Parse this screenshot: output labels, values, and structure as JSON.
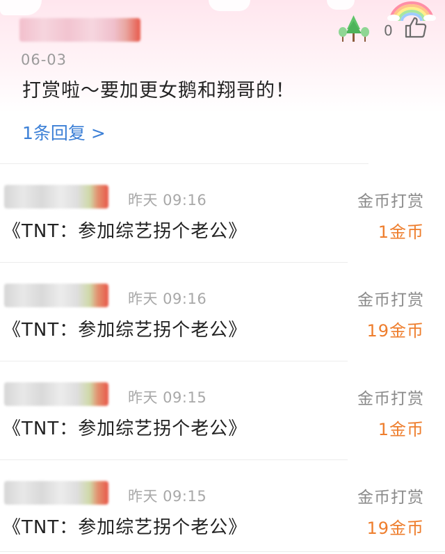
{
  "comment_card": {
    "date": "06-03",
    "text": "打赏啦～要加更女鹅和翔哥的！",
    "like_count": "0",
    "reply_link": "1条回复 >"
  },
  "rewards": [
    {
      "time": "昨天 09:16",
      "type": "金币打赏",
      "title": "《TNT：参加综艺拐个老公》",
      "amount": "1金币"
    },
    {
      "time": "昨天 09:16",
      "type": "金币打赏",
      "title": "《TNT：参加综艺拐个老公》",
      "amount": "19金币"
    },
    {
      "time": "昨天 09:15",
      "type": "金币打赏",
      "title": "《TNT：参加综艺拐个老公》",
      "amount": "1金币"
    },
    {
      "time": "昨天 09:15",
      "type": "金币打赏",
      "title": "《TNT：参加综艺拐个老公》",
      "amount": "19金币"
    }
  ],
  "icons": {
    "like": "thumbs-up-icon",
    "trees": "trees-icon",
    "rainbow": "rainbow-icon"
  },
  "colors": {
    "link": "#3b7fd6",
    "coin_amount": "#ee7d2c",
    "header_tint": "#ffe6ee"
  }
}
